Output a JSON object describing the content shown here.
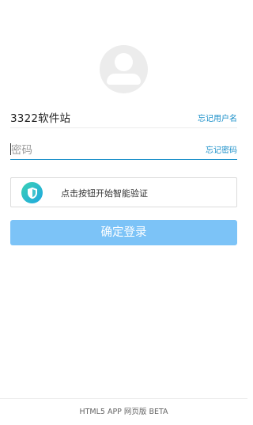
{
  "login": {
    "username": "3322软件站",
    "forgot_username": "忘记用户名",
    "password_placeholder": "密码",
    "forgot_password": "忘记密码"
  },
  "verify": {
    "icon": "shield-check-icon",
    "label": "点击按钮开始智能验证"
  },
  "submit": {
    "label": "确定登录"
  },
  "footer": {
    "text": "HTML5 APP 网页版 BETA"
  },
  "colors": {
    "accent": "#1a8fc9",
    "button": "#7cc3f7",
    "shield_gradient_start": "#3ad1b4",
    "shield_gradient_end": "#1ea7e0"
  }
}
